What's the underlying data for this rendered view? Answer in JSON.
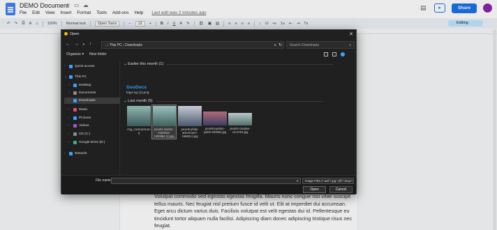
{
  "app": {
    "doc_title": "DEMO Document",
    "menu": [
      "File",
      "Edit",
      "View",
      "Insert",
      "Format",
      "Tools",
      "Add-ons",
      "Help"
    ],
    "last_edit": "Last edit was 2 minutes ago",
    "share_label": "Share",
    "meet_icon": "video-icon",
    "colors": {
      "accent": "#1a73e8",
      "folder": "#f0c000",
      "link": "#2e9bff"
    }
  },
  "toolbar": {
    "zoom": "100%",
    "style": "Normal text",
    "font": "Open Sans",
    "font_size": "12",
    "editing_mode": "Editing"
  },
  "document": {
    "visible_text": "Volutpat commodo sed egestas egestas fringilla. Mauris nunc congue nisi vitae suscipit tellus mauris. Nec feugiat nisl pretium fusce id velit ut. Elit at imperdiet dui accumsan. Eget arcu dictum varius duis. Facilisis volutpat est velit egestas dui id. Pellentesque eu tincidunt tortor aliquam nulla facilisi. Adipiscing diam donec adipiscing tristique risus nec feugiat."
  },
  "dialog": {
    "title": "Open",
    "breadcrumb": [
      "This PC",
      "Downloads"
    ],
    "search_placeholder": "Search Downloads",
    "organize_label": "Organize",
    "new_folder_label": "New folder",
    "sidebar": [
      {
        "label": "Quick access",
        "icon": "star-icon",
        "color": "#3aa2ff"
      },
      {
        "label": "This PC",
        "icon": "pc-icon",
        "color": "#3aa2ff"
      },
      {
        "label": "Desktop",
        "icon": "desktop-icon",
        "color": "#3aa2ff"
      },
      {
        "label": "Documents",
        "icon": "documents-icon",
        "color": "#8a8a8a"
      },
      {
        "label": "Downloads",
        "icon": "download-icon",
        "color": "#3aa2ff"
      },
      {
        "label": "Music",
        "icon": "music-icon",
        "color": "#e0506a"
      },
      {
        "label": "Pictures",
        "icon": "pictures-icon",
        "color": "#3aa2ff"
      },
      {
        "label": "Videos",
        "icon": "videos-icon",
        "color": "#9b59d0"
      },
      {
        "label": "OS (C:)",
        "icon": "drive-icon",
        "color": "#8a8a8a"
      },
      {
        "label": "Google Drive (D:)",
        "icon": "drive-icon",
        "color": "#3ab37a"
      },
      {
        "label": "Network",
        "icon": "network-icon",
        "color": "#3aa2ff"
      }
    ],
    "groups": {
      "earlier_this_month": "Earlier this month (1)",
      "last_month": "Last month (5)"
    },
    "godocs_logo_text": "GooDocs",
    "godocs_file": "logo-og (1).png",
    "files": [
      {
        "name": "img_coverpost.png",
        "colors": [
          "#8fb8b0",
          "#3d5a5c"
        ]
      },
      {
        "name": "pexels-marlon-martinez-1450084 (1).jpg",
        "colors": [
          "#9cc3c0",
          "#40625e"
        ]
      },
      {
        "name": "pexels-philip-ackermann-1666012.jpg",
        "colors": [
          "#c9c9d6",
          "#4a5a6e"
        ]
      },
      {
        "name": "pexels-jayston-judah-933054.jpg",
        "colors": [
          "#b46a78",
          "#3c3f66"
        ]
      },
      {
        "name": "pexels-creative-vix-9754.jpg",
        "colors": [
          "#b9c9cc",
          "#52706a"
        ]
      }
    ],
    "file_name_label": "File name:",
    "file_type": "Image Files (*.avif;*.jpg;*.jfif;*.bmp;*.webp)",
    "open_label": "Open",
    "cancel_label": "Cancel"
  }
}
